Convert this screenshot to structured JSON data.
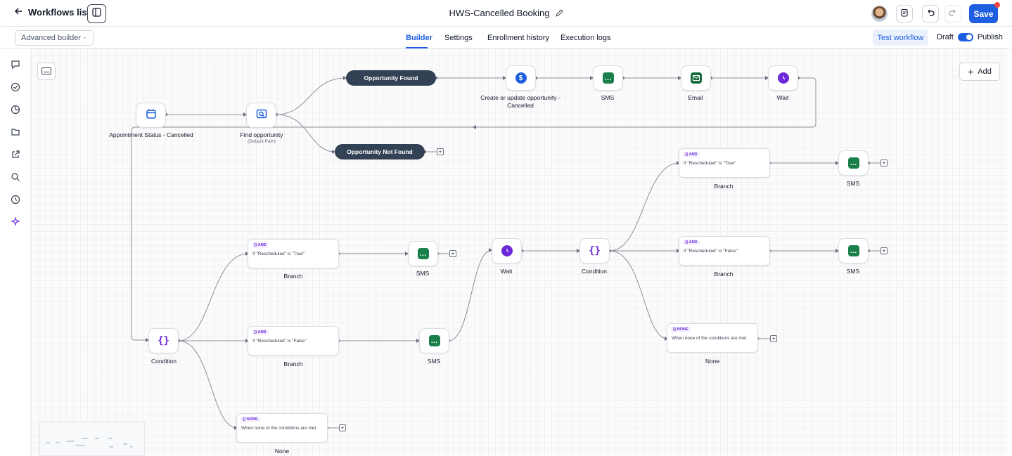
{
  "header": {
    "back_label": "Workflows list",
    "title": "HWS-Cancelled Booking",
    "save_label": "Save"
  },
  "subbar": {
    "builder_mode": "Advanced builder",
    "tabs": [
      "Builder",
      "Settings",
      "Enrollment history",
      "Execution logs"
    ],
    "active_tab": "Builder",
    "test_label": "Test workflow",
    "draft_label": "Draft",
    "publish_label": "Publish",
    "published": true
  },
  "canvas": {
    "add_label": "Add",
    "nodes": {
      "trigger_label": "Appointment Status - Cancelled",
      "find_label": "Find opportunity",
      "find_sub": "(Default Path)",
      "opp_found": "Opportunity Found",
      "opp_not_found": "Opportunity Not Found",
      "create_label": "Create or update opportunity - Cancelled",
      "sms_label": "SMS",
      "email_label": "Email",
      "wait_label": "Wait",
      "condition_label": "Condition",
      "branch_label": "Branch",
      "none_label": "None",
      "and_tag": "{} AND",
      "none_tag": "{} NONE",
      "cond_true": "If \"Rescheduled\" is \"True\"",
      "cond_false": "If \"Rescheduled\" is \"False\"",
      "cond_none": "When none of the conditions are met"
    }
  },
  "colors": {
    "accent": "#1d5fe0",
    "sms_green": "#1a7f4b",
    "email_green": "#166c3b",
    "wait_purple": "#6d28d9",
    "pill_dark": "#334155"
  }
}
